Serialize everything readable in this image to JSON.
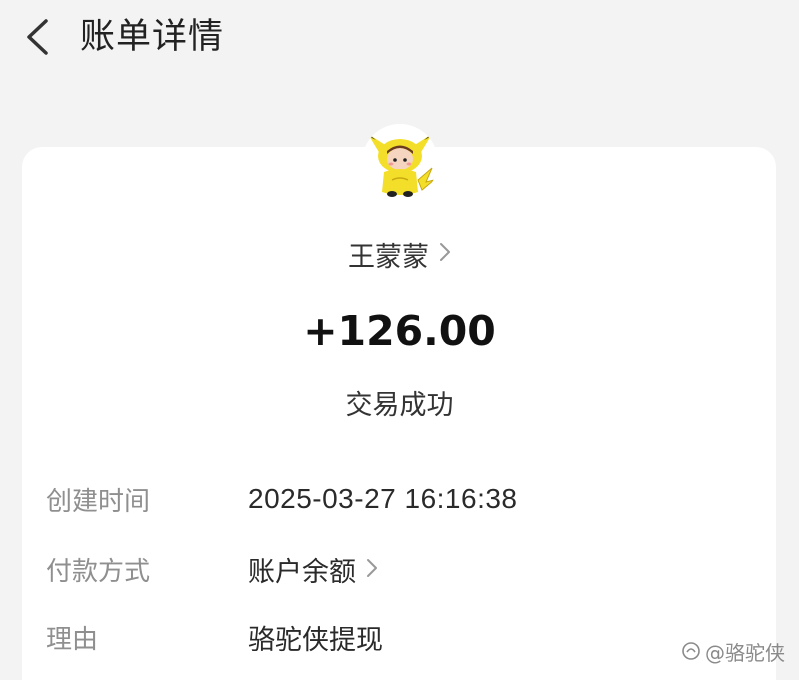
{
  "header": {
    "title": "账单详情"
  },
  "transaction": {
    "payee": "王蒙蒙",
    "amount": "+126.00",
    "status": "交易成功"
  },
  "details": {
    "created_time": {
      "label": "创建时间",
      "value": "2025-03-27 16:16:38"
    },
    "payment_method": {
      "label": "付款方式",
      "value": "账户余额"
    },
    "reason": {
      "label": "理由",
      "value": "骆驼侠提现"
    }
  },
  "watermark": {
    "text": "@骆驼侠"
  },
  "icons": [
    "back-arrow-icon",
    "avatar-pikachu-costume",
    "chevron-right-icon",
    "watermark-logo-icon"
  ],
  "colors": {
    "background": "#f3f3f3",
    "card": "#ffffff",
    "label": "#8f8f8f",
    "text": "#2a2a2a"
  }
}
